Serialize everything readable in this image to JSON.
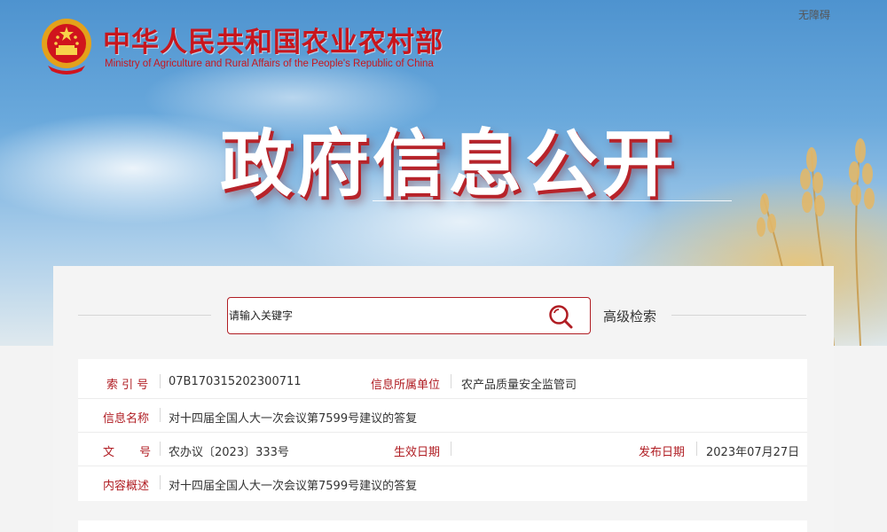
{
  "header": {
    "site_name_cn": "中华人民共和国农业农村部",
    "site_name_en": "Ministry of Agriculture and Rural Affairs of the People's Republic of China",
    "accessibility_label": "无障碍",
    "banner_title": "政府信息公开"
  },
  "search": {
    "placeholder": "请输入关键字",
    "advanced_label": "高级检索"
  },
  "info": {
    "index_label": "索 引 号",
    "index_value": "07B170315202300711",
    "org_label": "信息所属单位",
    "org_value": "农产品质量安全监管司",
    "name_label": "信息名称",
    "name_value": "对十四届全国人大一次会议第7599号建议的答复",
    "doc_label": "文 号",
    "doc_value": "农办议〔2023〕333号",
    "effective_label": "生效日期",
    "effective_value": "",
    "publish_label": "发布日期",
    "publish_value": "2023年07月27日",
    "summary_label": "内容概述",
    "summary_value": "对十四届全国人大一次会议第7599号建议的答复"
  },
  "colors": {
    "brand_red": "#c8161d",
    "label_red": "#b01d23"
  },
  "icons": {
    "emblem": "national-emblem-icon",
    "search": "search-icon"
  }
}
